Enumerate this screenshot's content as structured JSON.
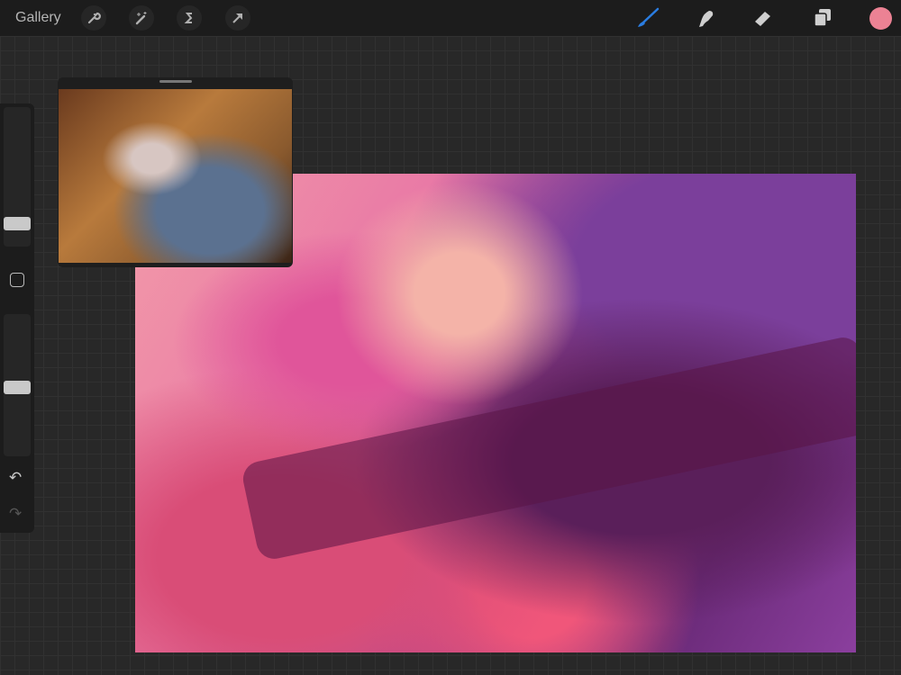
{
  "topbar": {
    "gallery_label": "Gallery",
    "left_tools": [
      "wrench-icon",
      "magic-wand-icon",
      "selection-icon",
      "transform-arrow-icon"
    ],
    "right_tools": [
      "brush-icon",
      "smudge-icon",
      "eraser-icon",
      "layers-icon"
    ],
    "current_color": "#ec8294",
    "accent": "#2a7de1"
  },
  "sidebar": {
    "brush_size": 0.25,
    "brush_opacity": 0.5
  }
}
